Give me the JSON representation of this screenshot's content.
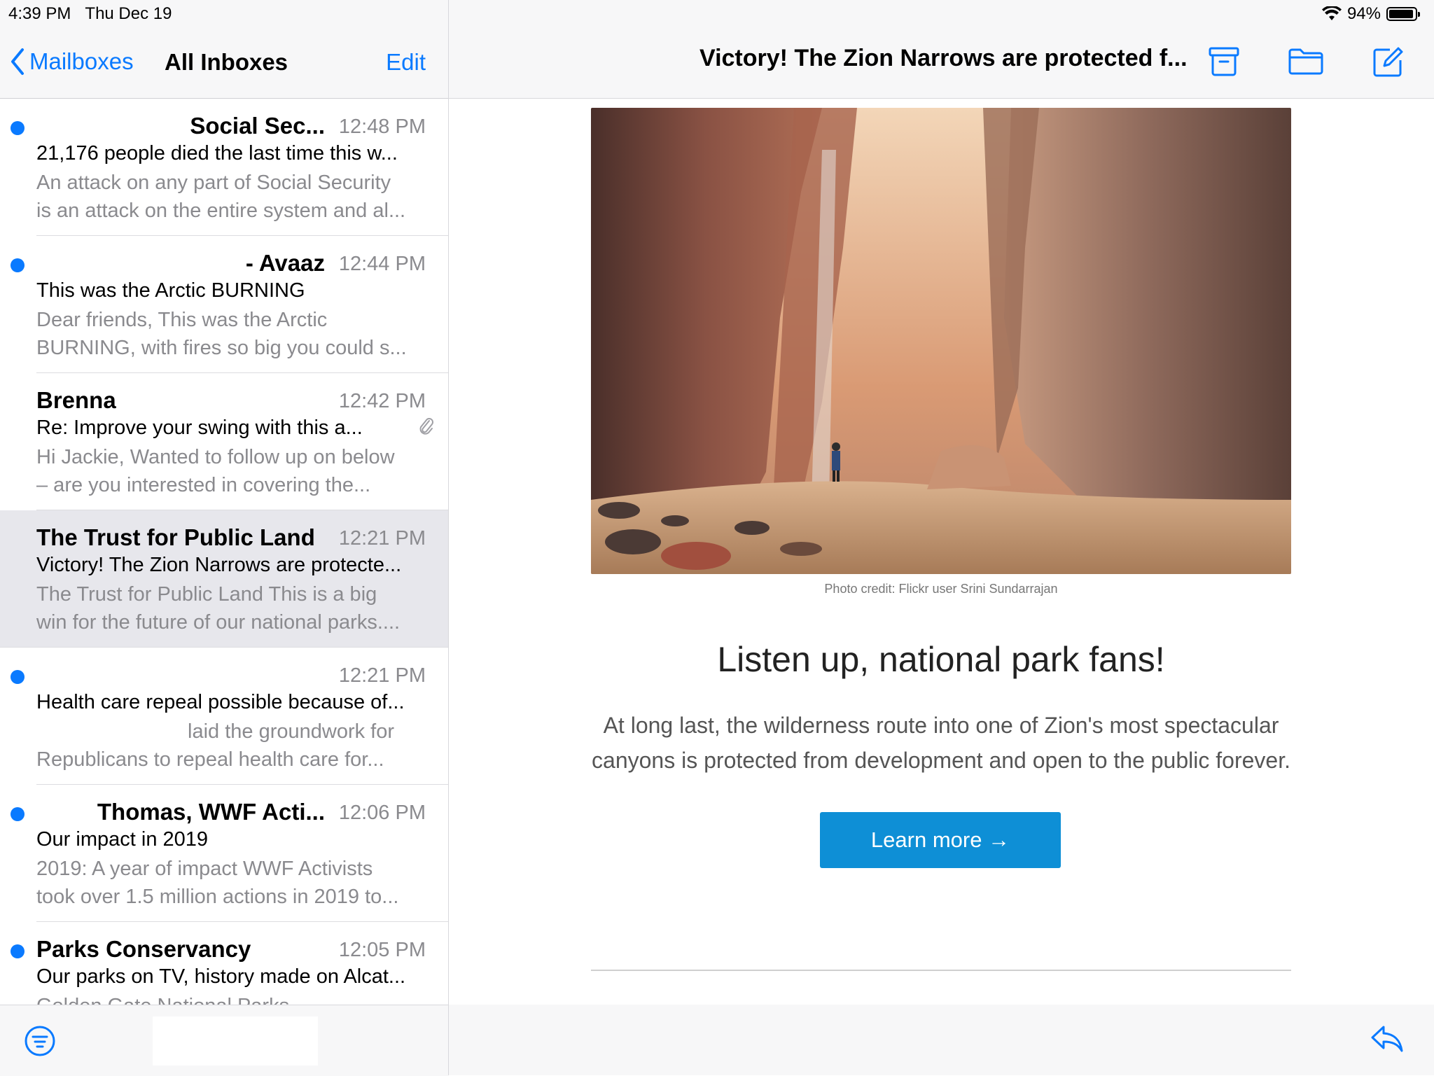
{
  "status": {
    "time": "4:39 PM",
    "date": "Thu Dec 19",
    "battery": "94%",
    "battery_level": 0.94
  },
  "left_nav": {
    "back_label": "Mailboxes",
    "title": "All Inboxes",
    "edit_label": "Edit"
  },
  "messages": [
    {
      "sender": "Social Sec...",
      "time": "12:48 PM",
      "subject": "21,176 people died the last time this w...",
      "preview_1": "An attack on any part of Social Security",
      "preview_2": "is an attack on the entire system and al...",
      "unread": true
    },
    {
      "sender": "- Avaaz",
      "time": "12:44 PM",
      "subject": "This was the Arctic BURNING",
      "preview_1": "Dear friends, This was the Arctic",
      "preview_2": "BURNING, with fires so big you could s...",
      "unread": true
    },
    {
      "sender": "Brenna",
      "time": "12:42 PM",
      "subject": "Re:  Improve your swing with this a...",
      "preview_1": "Hi Jackie, Wanted to follow up on below",
      "preview_2": "– are you interested in covering the...",
      "unread": false,
      "attachment": "paperclip-icon"
    },
    {
      "sender": "The Trust for Public Land",
      "time": "12:21 PM",
      "subject": "Victory! The Zion Narrows are protecte...",
      "preview_1": "The Trust for Public Land This is a big",
      "preview_2": "win for the future of our national parks....",
      "unread": false,
      "selected": true
    },
    {
      "sender": "",
      "time": "12:21 PM",
      "subject": "Health care repeal possible because of...",
      "preview_1": "laid the groundwork for",
      "preview_2": "Republicans to repeal health care for...",
      "unread": true
    },
    {
      "sender": "Thomas, WWF Acti...",
      "time": "12:06 PM",
      "subject": "Our impact in 2019",
      "preview_1": "2019: A year of impact WWF Activists",
      "preview_2": "took over 1.5 million actions in 2019 to...",
      "unread": true
    },
    {
      "sender": "Parks Conservancy",
      "time": "12:05 PM",
      "subject": "Our parks on TV, history made on Alcat...",
      "preview_1": "Golden Gate National Parks",
      "preview_2": "",
      "unread": true
    }
  ],
  "email": {
    "title": "Victory! The Zion Narrows are protected f...",
    "photo_credit": "Photo credit: Flickr user Srini Sundarrajan",
    "headline": "Listen up, national park fans!",
    "body": "At long last, the wilderness route into one of Zion's most spectacular canyons is protected from development and open to the public forever.",
    "cta_label": "Learn more →"
  },
  "colors": {
    "accent": "#0a7aff",
    "cta": "#0e8fd6",
    "unread_dot": "#0a7aff"
  },
  "icons": [
    "chevron-left-icon",
    "archive-icon",
    "folder-icon",
    "compose-icon",
    "filter-icon",
    "reply-icon",
    "wifi-icon",
    "battery-icon",
    "paperclip-icon"
  ]
}
